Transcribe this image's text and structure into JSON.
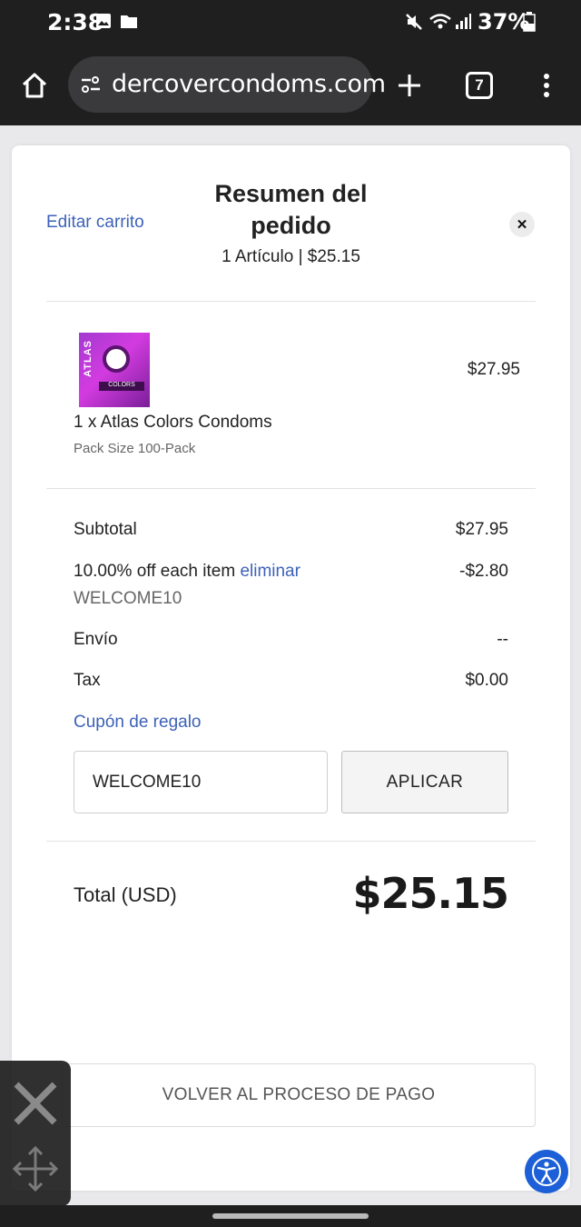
{
  "status": {
    "time": "2:38",
    "battery": "37%"
  },
  "browser": {
    "url": "dercovercondoms.com",
    "tab_count": "7"
  },
  "summary": {
    "title": "Resumen del pedido",
    "subtitle": "1 Artículo | $25.15",
    "edit_cart": "Editar carrito"
  },
  "item": {
    "name": "1 x Atlas Colors Condoms",
    "option": "Pack Size 100-Pack",
    "price": "$27.95",
    "thumb_text": "ATLAS",
    "thumb_band": "COLORS"
  },
  "totals": {
    "subtotal_label": "Subtotal",
    "subtotal_value": "$27.95",
    "discount_label": "10.00% off each item",
    "discount_remove": "eliminar",
    "discount_code": "WELCOME10",
    "discount_value": "-$2.80",
    "shipping_label": "Envío",
    "shipping_value": "--",
    "tax_label": "Tax",
    "tax_value": "$0.00"
  },
  "coupon": {
    "link": "Cupón de regalo",
    "value": "WELCOME10",
    "apply": "APLICAR"
  },
  "grand_total": {
    "label": "Total (USD)",
    "value": "$25.15"
  },
  "back_button": "VOLVER AL PROCESO DE PAGO",
  "colors": {
    "link": "#3d62b8",
    "accessibility": "#1d5fd6",
    "chrome": "#1f1f1f"
  }
}
